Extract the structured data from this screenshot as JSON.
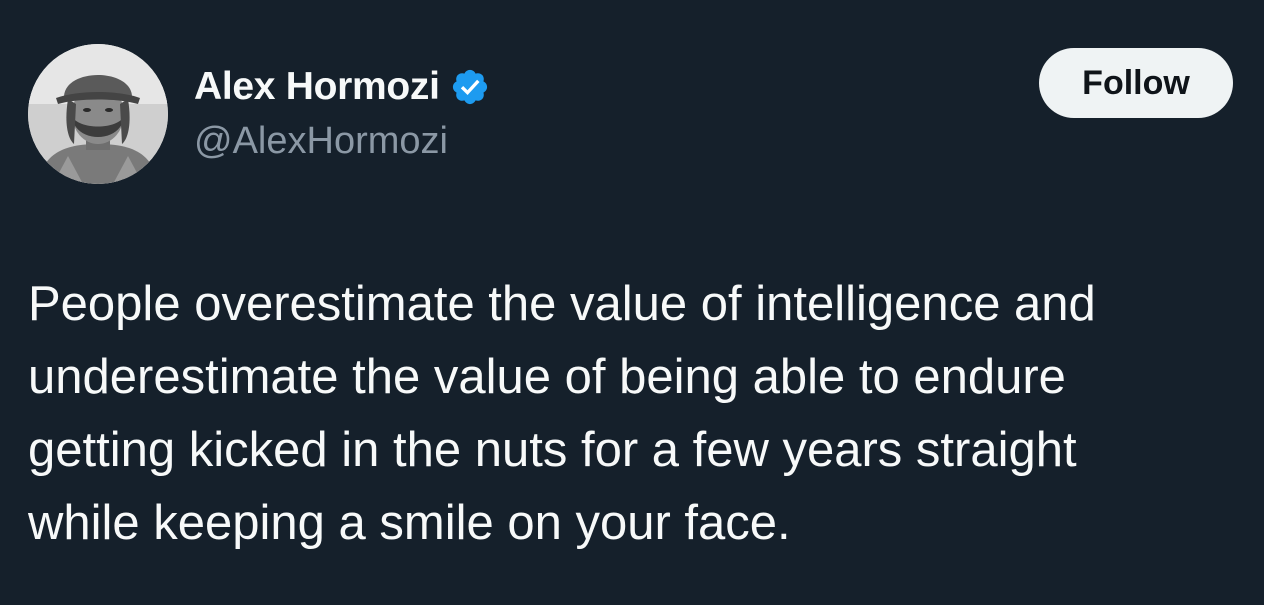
{
  "author": {
    "display_name": "Alex Hormozi",
    "handle": "@AlexHormozi",
    "verified": true,
    "verified_badge_color": "#1d9bf0",
    "avatar_icon": "user-avatar-photo"
  },
  "actions": {
    "follow_label": "Follow"
  },
  "tweet": {
    "lines": [
      "People overestimate the value of intelligence and",
      "underestimate the value of being able to endure",
      "getting kicked in the nuts for a few years straight",
      "while keeping a smile on your face."
    ]
  },
  "theme": {
    "background": "#15202b",
    "text_primary": "#f7f9f9",
    "text_secondary": "#8b98a5",
    "button_bg": "#eff3f4"
  }
}
